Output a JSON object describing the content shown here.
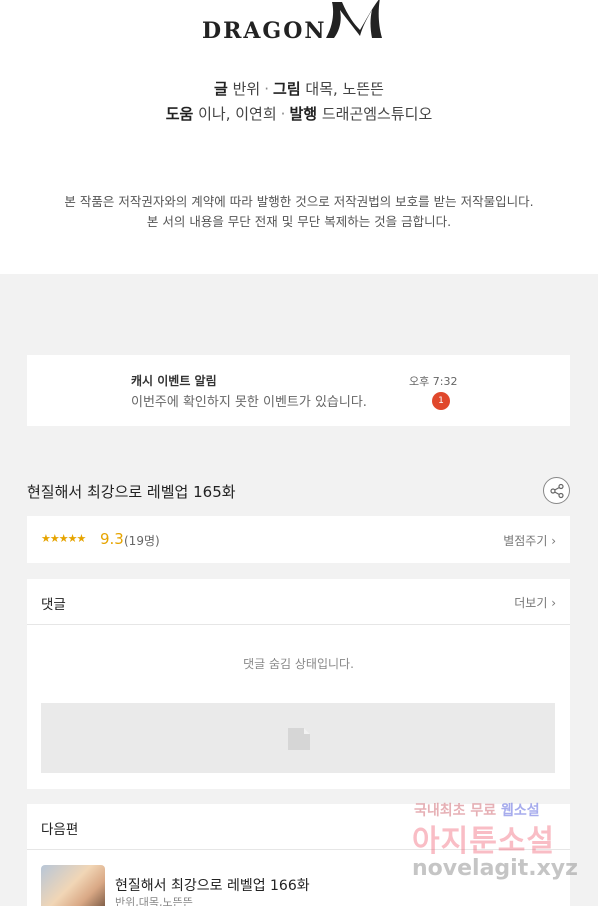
{
  "logo": {
    "text": "DRAGON",
    "mark": "M"
  },
  "credits": {
    "writer_label": "글",
    "writer": "반위",
    "artist_label": "그림",
    "artist": "대목, 노뜬뜬",
    "assist_label": "도움",
    "assist": "이나, 이연희",
    "publisher_label": "발행",
    "publisher": "드래곤엠스튜디오",
    "separator": "·"
  },
  "notice": {
    "line1": "본 작품은 저작권자와의 계약에 따라 발행한 것으로 저작권법의 보호를 받는 저작물입니다.",
    "line2": "본 서의 내용을 무단 전재 및 무단 복제하는 것을 금합니다."
  },
  "alarm": {
    "title": "캐시 이벤트 알림",
    "body": "이번주에 확인하지 못한 이벤트가 있습니다.",
    "time": "오후 7:32",
    "badge": "1"
  },
  "episode": {
    "title": "현질해서 최강으로 레벨업 165화",
    "share_icon": "share-icon"
  },
  "rating": {
    "stars": "★★★★★",
    "score": "9.3",
    "votes": "(19명)",
    "rate_link": "별점주기 ›",
    "star_color": "#e6a400"
  },
  "comments": {
    "title": "댓글",
    "more": "더보기 ›",
    "hidden_msg": "댓글 숨김 상태입니다."
  },
  "next": {
    "title": "다음편",
    "episode_title": "현질해서 최강으로 레벨업 166화",
    "authors": "반위,대목,노뜬뜬"
  },
  "watermark": {
    "line1_a": "국내최초 무료",
    "line1_b": "웹소설",
    "line2": "아지툰소설",
    "line3": "novelagit.xyz"
  },
  "colors": {
    "badge": "#e0482c",
    "accent": "#e6a400"
  }
}
